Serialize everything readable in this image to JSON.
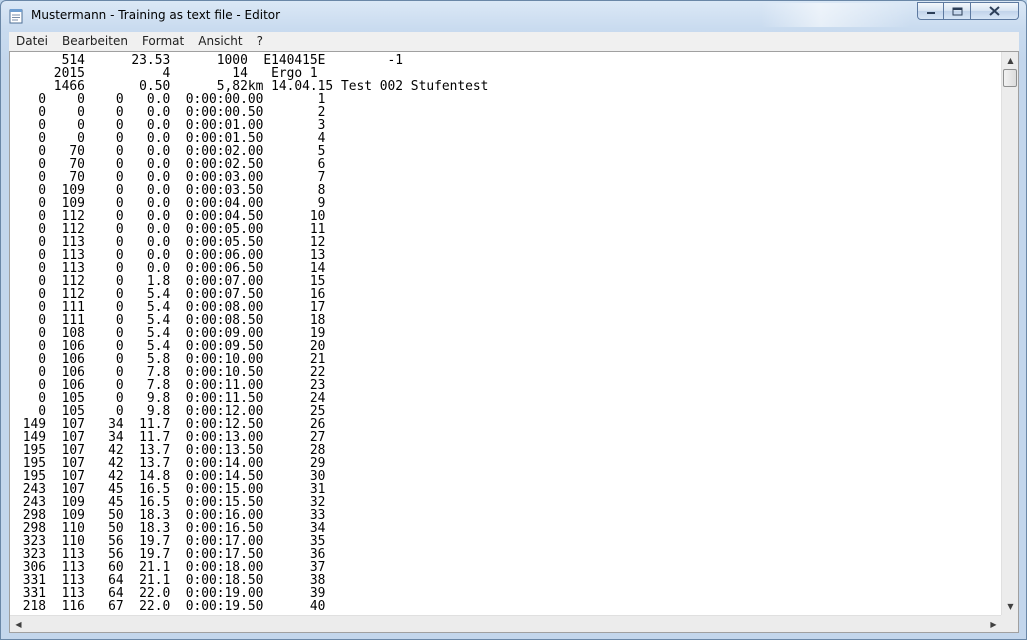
{
  "window": {
    "title": "Mustermann - Training as text file - Editor"
  },
  "menu": [
    "Datei",
    "Bearbeiten",
    "Format",
    "Ansicht",
    "?"
  ],
  "icons": {
    "app": "notepad-icon",
    "minimize": "minimize-icon",
    "maximize": "maximize-icon",
    "close": "close-icon",
    "scroll_up": "scroll-up-arrow-icon",
    "scroll_down": "scroll-down-arrow-icon",
    "scroll_left": "scroll-left-arrow-icon",
    "scroll_right": "scroll-right-arrow-icon"
  },
  "document": {
    "lines": [
      "      514      23.53      1000  E140415E        -1",
      "     2015          4        14   Ergo 1",
      "     1466       0.50      5,82km 14.04.15 Test 002 Stufentest",
      "   0    0    0   0.0  0:00:00.00       1",
      "   0    0    0   0.0  0:00:00.50       2",
      "   0    0    0   0.0  0:00:01.00       3",
      "   0    0    0   0.0  0:00:01.50       4",
      "   0   70    0   0.0  0:00:02.00       5",
      "   0   70    0   0.0  0:00:02.50       6",
      "   0   70    0   0.0  0:00:03.00       7",
      "   0  109    0   0.0  0:00:03.50       8",
      "   0  109    0   0.0  0:00:04.00       9",
      "   0  112    0   0.0  0:00:04.50      10",
      "   0  112    0   0.0  0:00:05.00      11",
      "   0  113    0   0.0  0:00:05.50      12",
      "   0  113    0   0.0  0:00:06.00      13",
      "   0  113    0   0.0  0:00:06.50      14",
      "   0  112    0   1.8  0:00:07.00      15",
      "   0  112    0   5.4  0:00:07.50      16",
      "   0  111    0   5.4  0:00:08.00      17",
      "   0  111    0   5.4  0:00:08.50      18",
      "   0  108    0   5.4  0:00:09.00      19",
      "   0  106    0   5.4  0:00:09.50      20",
      "   0  106    0   5.8  0:00:10.00      21",
      "   0  106    0   7.8  0:00:10.50      22",
      "   0  106    0   7.8  0:00:11.00      23",
      "   0  105    0   9.8  0:00:11.50      24",
      "   0  105    0   9.8  0:00:12.00      25",
      " 149  107   34  11.7  0:00:12.50      26",
      " 149  107   34  11.7  0:00:13.00      27",
      " 195  107   42  13.7  0:00:13.50      28",
      " 195  107   42  13.7  0:00:14.00      29",
      " 195  107   42  14.8  0:00:14.50      30",
      " 243  107   45  16.5  0:00:15.00      31",
      " 243  109   45  16.5  0:00:15.50      32",
      " 298  109   50  18.3  0:00:16.00      33",
      " 298  110   50  18.3  0:00:16.50      34",
      " 323  110   56  19.7  0:00:17.00      35",
      " 323  113   56  19.7  0:00:17.50      36",
      " 306  113   60  21.1  0:00:18.00      37",
      " 331  113   64  21.1  0:00:18.50      38",
      " 331  113   64  22.0  0:00:19.00      39",
      " 218  116   67  22.0  0:00:19.50      40"
    ]
  }
}
